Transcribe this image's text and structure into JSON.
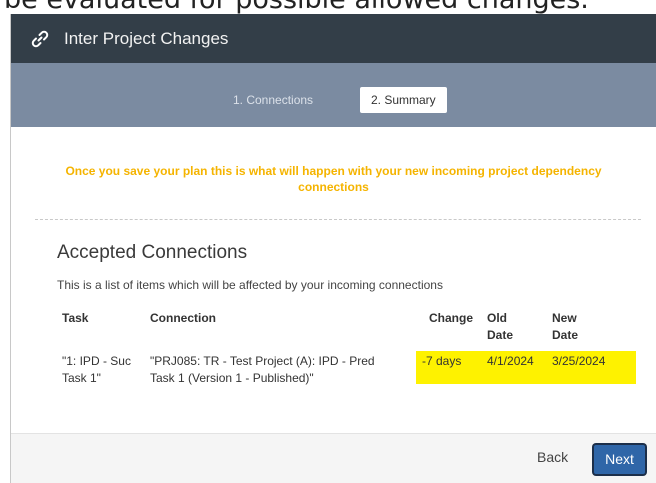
{
  "background_text": "be evaluated for possible allowed changes.",
  "dialog": {
    "title": "Inter Project Changes",
    "title_icon": "link-icon"
  },
  "steps": [
    {
      "label": "1. Connections",
      "active": false
    },
    {
      "label": "2. Summary",
      "active": true
    }
  ],
  "notice": "Once you save your plan this is what will happen with your new incoming project dependency connections",
  "section": {
    "heading": "Accepted Connections",
    "description": "This is a list of items which will be affected by your incoming connections"
  },
  "table": {
    "headers": {
      "task": "Task",
      "connection": "Connection",
      "change": "Change",
      "old_date_1": "Old",
      "old_date_2": "Date",
      "new_date_1": "New",
      "new_date_2": "Date"
    },
    "rows": [
      {
        "task_1": "\"1: IPD - Suc",
        "task_2": "Task 1\"",
        "connection_1": "\"PRJ085: TR - Test Project (A): IPD - Pred",
        "connection_2": "Task 1 (Version 1 - Published)\"",
        "change": "-7 days",
        "old_date": "4/1/2024",
        "new_date": "3/25/2024"
      }
    ]
  },
  "footer": {
    "back_label": "Back",
    "next_label": "Next"
  },
  "colors": {
    "title_bar": "#333e48",
    "step_bar": "#7b8ba1",
    "notice_text": "#f5b400",
    "highlight": "#fef200",
    "primary_button": "#2f66a8"
  }
}
